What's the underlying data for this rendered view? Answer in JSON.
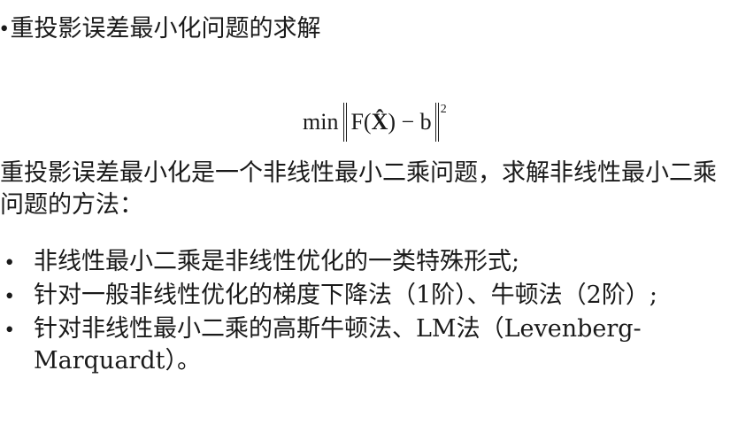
{
  "heading": {
    "bullet": "•",
    "text": "重投影误差最小化问题的求解"
  },
  "formula": {
    "min": "min",
    "f_open": "F(",
    "x_hat": "X̂",
    "f_close": ") − b",
    "exponent": "2"
  },
  "paragraph": "重投影误差最小化是一个非线性最小二乘问题，求解非线性最小二乘问题的方法：",
  "items": [
    {
      "bullet": "•",
      "text": "非线性最小二乘是非线性优化的一类特殊形式;"
    },
    {
      "bullet": "•",
      "text": "针对一般非线性优化的梯度下降法（1阶）、牛顿法（2阶）;"
    },
    {
      "bullet": "•",
      "text": "针对非线性最小二乘的高斯牛顿法、LM法（Levenberg-Marquardt）。"
    }
  ]
}
